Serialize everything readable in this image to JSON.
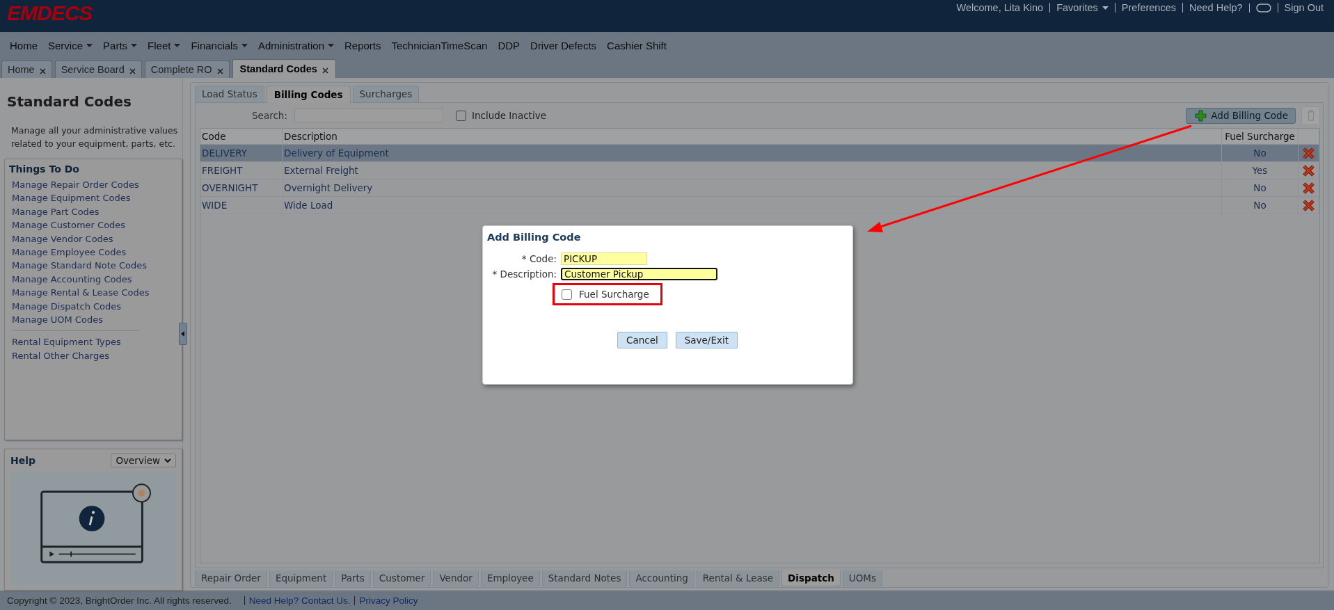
{
  "header": {
    "logo": "EMDECS",
    "user_links": [
      {
        "label": "Welcome, Lita Kino",
        "kind": "text"
      },
      {
        "label": "Favorites",
        "kind": "link",
        "dropdown": true
      },
      {
        "label": "Preferences",
        "kind": "link"
      },
      {
        "label": "Need Help?",
        "kind": "link"
      },
      {
        "kind": "toggle"
      },
      {
        "label": "Sign Out",
        "kind": "link"
      }
    ]
  },
  "nav_menu": [
    {
      "label": "Home"
    },
    {
      "label": "Service",
      "dropdown": true
    },
    {
      "label": "Parts",
      "dropdown": true
    },
    {
      "label": "Fleet",
      "dropdown": true
    },
    {
      "label": "Financials",
      "dropdown": true
    },
    {
      "label": "Administration",
      "dropdown": true
    },
    {
      "label": "Reports"
    },
    {
      "label": "TechnicianTimeScan"
    },
    {
      "label": "DDP"
    },
    {
      "label": "Driver Defects"
    },
    {
      "label": "Cashier Shift"
    }
  ],
  "page_tabs": [
    {
      "label": "Home",
      "selected": false
    },
    {
      "label": "Service Board",
      "selected": false
    },
    {
      "label": "Complete RO",
      "selected": false
    },
    {
      "label": "Standard Codes",
      "selected": true
    }
  ],
  "sidebar": {
    "title": "Standard Codes",
    "description": "Manage all your administrative values related to your equipment, parts, etc.",
    "things_to_do": {
      "title": "Things To Do",
      "links": [
        "Manage Repair Order Codes",
        "Manage Equipment Codes",
        "Manage Part Codes",
        "Manage Customer Codes",
        "Manage Vendor Codes",
        "Manage Employee Codes",
        "Manage Standard Note Codes",
        "Manage Accounting Codes",
        "Manage Rental & Lease Codes",
        "Manage Dispatch Codes",
        "Manage UOM Codes"
      ],
      "extra_links": [
        "Rental Equipment Types",
        "Rental Other Charges"
      ]
    },
    "help": {
      "title": "Help",
      "select": "Overview"
    }
  },
  "main": {
    "sub_tabs": [
      {
        "label": "Load Status",
        "selected": false
      },
      {
        "label": "Billing Codes",
        "selected": true
      },
      {
        "label": "Surcharges",
        "selected": false
      }
    ],
    "search": {
      "label": "Search:"
    },
    "include_inactive": {
      "label": "Include Inactive",
      "checked": false
    },
    "add_button": "Add Billing Code",
    "table": {
      "columns": [
        "Code",
        "Description",
        "Fuel Surcharge"
      ],
      "rows": [
        {
          "code": "DELIVERY",
          "description": "Delivery of Equipment",
          "fuel_surcharge": "No",
          "selected": true
        },
        {
          "code": "FREIGHT",
          "description": "External Freight",
          "fuel_surcharge": "Yes",
          "selected": false
        },
        {
          "code": "OVERNIGHT",
          "description": "Overnight Delivery",
          "fuel_surcharge": "No",
          "selected": false
        },
        {
          "code": "WIDE",
          "description": "Wide Load",
          "fuel_surcharge": "No",
          "selected": false
        }
      ]
    },
    "bottom_tabs": [
      {
        "label": "Repair Order",
        "selected": false
      },
      {
        "label": "Equipment",
        "selected": false
      },
      {
        "label": "Parts",
        "selected": false
      },
      {
        "label": "Customer",
        "selected": false
      },
      {
        "label": "Vendor",
        "selected": false
      },
      {
        "label": "Employee",
        "selected": false
      },
      {
        "label": "Standard Notes",
        "selected": false
      },
      {
        "label": "Accounting",
        "selected": false
      },
      {
        "label": "Rental & Lease",
        "selected": false
      },
      {
        "label": "Dispatch",
        "selected": true
      },
      {
        "label": "UOMs",
        "selected": false
      }
    ]
  },
  "dialog": {
    "title": "Add Billing Code",
    "fields": [
      {
        "label": "* Code:",
        "value": "PICKUP",
        "focused": false
      },
      {
        "label": "* Description:",
        "value": "Customer Pickup",
        "focused": true
      }
    ],
    "fuel_surcharge": {
      "label": "Fuel Surcharge",
      "checked": false
    },
    "buttons": [
      "Cancel",
      "Save/Exit"
    ]
  },
  "footer": {
    "copyright": "Copyright © 2023, BrightOrder Inc. All rights reserved.",
    "links": [
      "Need Help? Contact Us.",
      "Privacy Policy"
    ]
  }
}
